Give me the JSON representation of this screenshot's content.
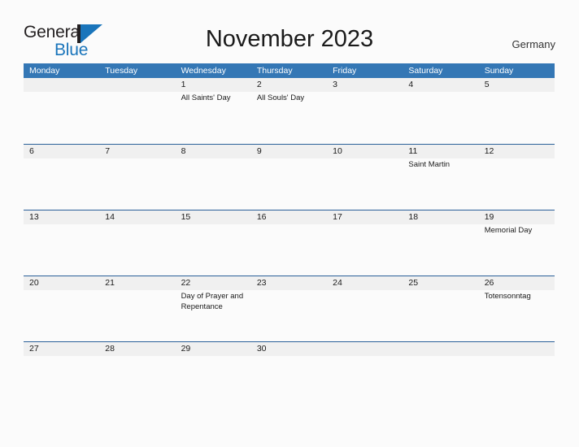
{
  "brand": {
    "name_part1": "General",
    "name_part2": "Blue",
    "mark_icon": "triangle-flag-icon",
    "color_primary": "#1a75bb",
    "color_dark": "#231f20"
  },
  "header": {
    "title": "November 2023",
    "country": "Germany"
  },
  "theme": {
    "header_bar": "#3477b5",
    "row_divider": "#2a6099",
    "date_band": "#f0f0f0",
    "page_background": "#fbfbfb",
    "text": "#1a1a1a"
  },
  "calendar": {
    "month": "November",
    "year": "2023",
    "weekday_headers": [
      "Monday",
      "Tuesday",
      "Wednesday",
      "Thursday",
      "Friday",
      "Saturday",
      "Sunday"
    ],
    "weeks": [
      {
        "days": [
          {
            "date": "",
            "events": []
          },
          {
            "date": "",
            "events": []
          },
          {
            "date": "1",
            "events": [
              "All Saints' Day"
            ]
          },
          {
            "date": "2",
            "events": [
              "All Souls' Day"
            ]
          },
          {
            "date": "3",
            "events": []
          },
          {
            "date": "4",
            "events": []
          },
          {
            "date": "5",
            "events": []
          }
        ]
      },
      {
        "days": [
          {
            "date": "6",
            "events": []
          },
          {
            "date": "7",
            "events": []
          },
          {
            "date": "8",
            "events": []
          },
          {
            "date": "9",
            "events": []
          },
          {
            "date": "10",
            "events": []
          },
          {
            "date": "11",
            "events": [
              "Saint Martin"
            ]
          },
          {
            "date": "12",
            "events": []
          }
        ]
      },
      {
        "days": [
          {
            "date": "13",
            "events": []
          },
          {
            "date": "14",
            "events": []
          },
          {
            "date": "15",
            "events": []
          },
          {
            "date": "16",
            "events": []
          },
          {
            "date": "17",
            "events": []
          },
          {
            "date": "18",
            "events": []
          },
          {
            "date": "19",
            "events": [
              "Memorial Day"
            ]
          }
        ]
      },
      {
        "days": [
          {
            "date": "20",
            "events": []
          },
          {
            "date": "21",
            "events": []
          },
          {
            "date": "22",
            "events": [
              "Day of Prayer and Repentance"
            ]
          },
          {
            "date": "23",
            "events": []
          },
          {
            "date": "24",
            "events": []
          },
          {
            "date": "25",
            "events": []
          },
          {
            "date": "26",
            "events": [
              "Totensonntag"
            ]
          }
        ]
      },
      {
        "days": [
          {
            "date": "27",
            "events": []
          },
          {
            "date": "28",
            "events": []
          },
          {
            "date": "29",
            "events": []
          },
          {
            "date": "30",
            "events": []
          },
          {
            "date": "",
            "events": []
          },
          {
            "date": "",
            "events": []
          },
          {
            "date": "",
            "events": []
          }
        ]
      }
    ]
  }
}
